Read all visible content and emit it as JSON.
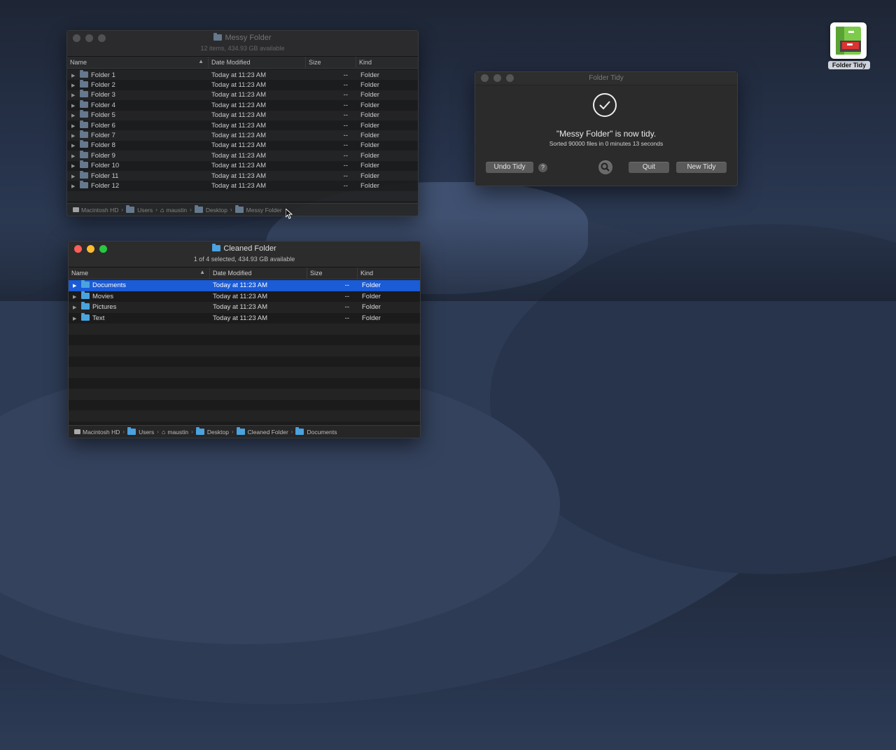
{
  "desktop": {
    "app_icon_label": "Folder Tidy"
  },
  "messy_window": {
    "title": "Messy Folder",
    "subtitle": "12 items, 434.93 GB available",
    "columns": {
      "name": "Name",
      "date": "Date Modified",
      "size": "Size",
      "kind": "Kind"
    },
    "rows": [
      {
        "name": "Folder 1",
        "date": "Today at 11:23 AM",
        "size": "--",
        "kind": "Folder"
      },
      {
        "name": "Folder 2",
        "date": "Today at 11:23 AM",
        "size": "--",
        "kind": "Folder"
      },
      {
        "name": "Folder 3",
        "date": "Today at 11:23 AM",
        "size": "--",
        "kind": "Folder"
      },
      {
        "name": "Folder 4",
        "date": "Today at 11:23 AM",
        "size": "--",
        "kind": "Folder"
      },
      {
        "name": "Folder 5",
        "date": "Today at 11:23 AM",
        "size": "--",
        "kind": "Folder"
      },
      {
        "name": "Folder 6",
        "date": "Today at 11:23 AM",
        "size": "--",
        "kind": "Folder"
      },
      {
        "name": "Folder 7",
        "date": "Today at 11:23 AM",
        "size": "--",
        "kind": "Folder"
      },
      {
        "name": "Folder 8",
        "date": "Today at 11:23 AM",
        "size": "--",
        "kind": "Folder"
      },
      {
        "name": "Folder 9",
        "date": "Today at 11:23 AM",
        "size": "--",
        "kind": "Folder"
      },
      {
        "name": "Folder 10",
        "date": "Today at 11:23 AM",
        "size": "--",
        "kind": "Folder"
      },
      {
        "name": "Folder 11",
        "date": "Today at 11:23 AM",
        "size": "--",
        "kind": "Folder"
      },
      {
        "name": "Folder 12",
        "date": "Today at 11:23 AM",
        "size": "--",
        "kind": "Folder"
      }
    ],
    "path": [
      "Macintosh HD",
      "Users",
      "maustin",
      "Desktop",
      "Messy Folder"
    ]
  },
  "cleaned_window": {
    "title": "Cleaned Folder",
    "subtitle": "1 of 4 selected, 434.93 GB available",
    "columns": {
      "name": "Name",
      "date": "Date Modified",
      "size": "Size",
      "kind": "Kind"
    },
    "rows": [
      {
        "name": "Documents",
        "date": "Today at 11:23 AM",
        "size": "--",
        "kind": "Folder",
        "selected": true
      },
      {
        "name": "Movies",
        "date": "Today at 11:23 AM",
        "size": "--",
        "kind": "Folder"
      },
      {
        "name": "Pictures",
        "date": "Today at 11:23 AM",
        "size": "--",
        "kind": "Folder"
      },
      {
        "name": "Text",
        "date": "Today at 11:23 AM",
        "size": "--",
        "kind": "Folder"
      }
    ],
    "path": [
      "Macintosh HD",
      "Users",
      "maustin",
      "Desktop",
      "Cleaned Folder",
      "Documents"
    ]
  },
  "tidy_dialog": {
    "title": "Folder Tidy",
    "message": "\"Messy Folder\" is now tidy.",
    "detail": "Sorted 90000 files in 0 minutes 13 seconds",
    "undo_label": "Undo Tidy",
    "help_label": "?",
    "quit_label": "Quit",
    "new_label": "New Tidy"
  }
}
